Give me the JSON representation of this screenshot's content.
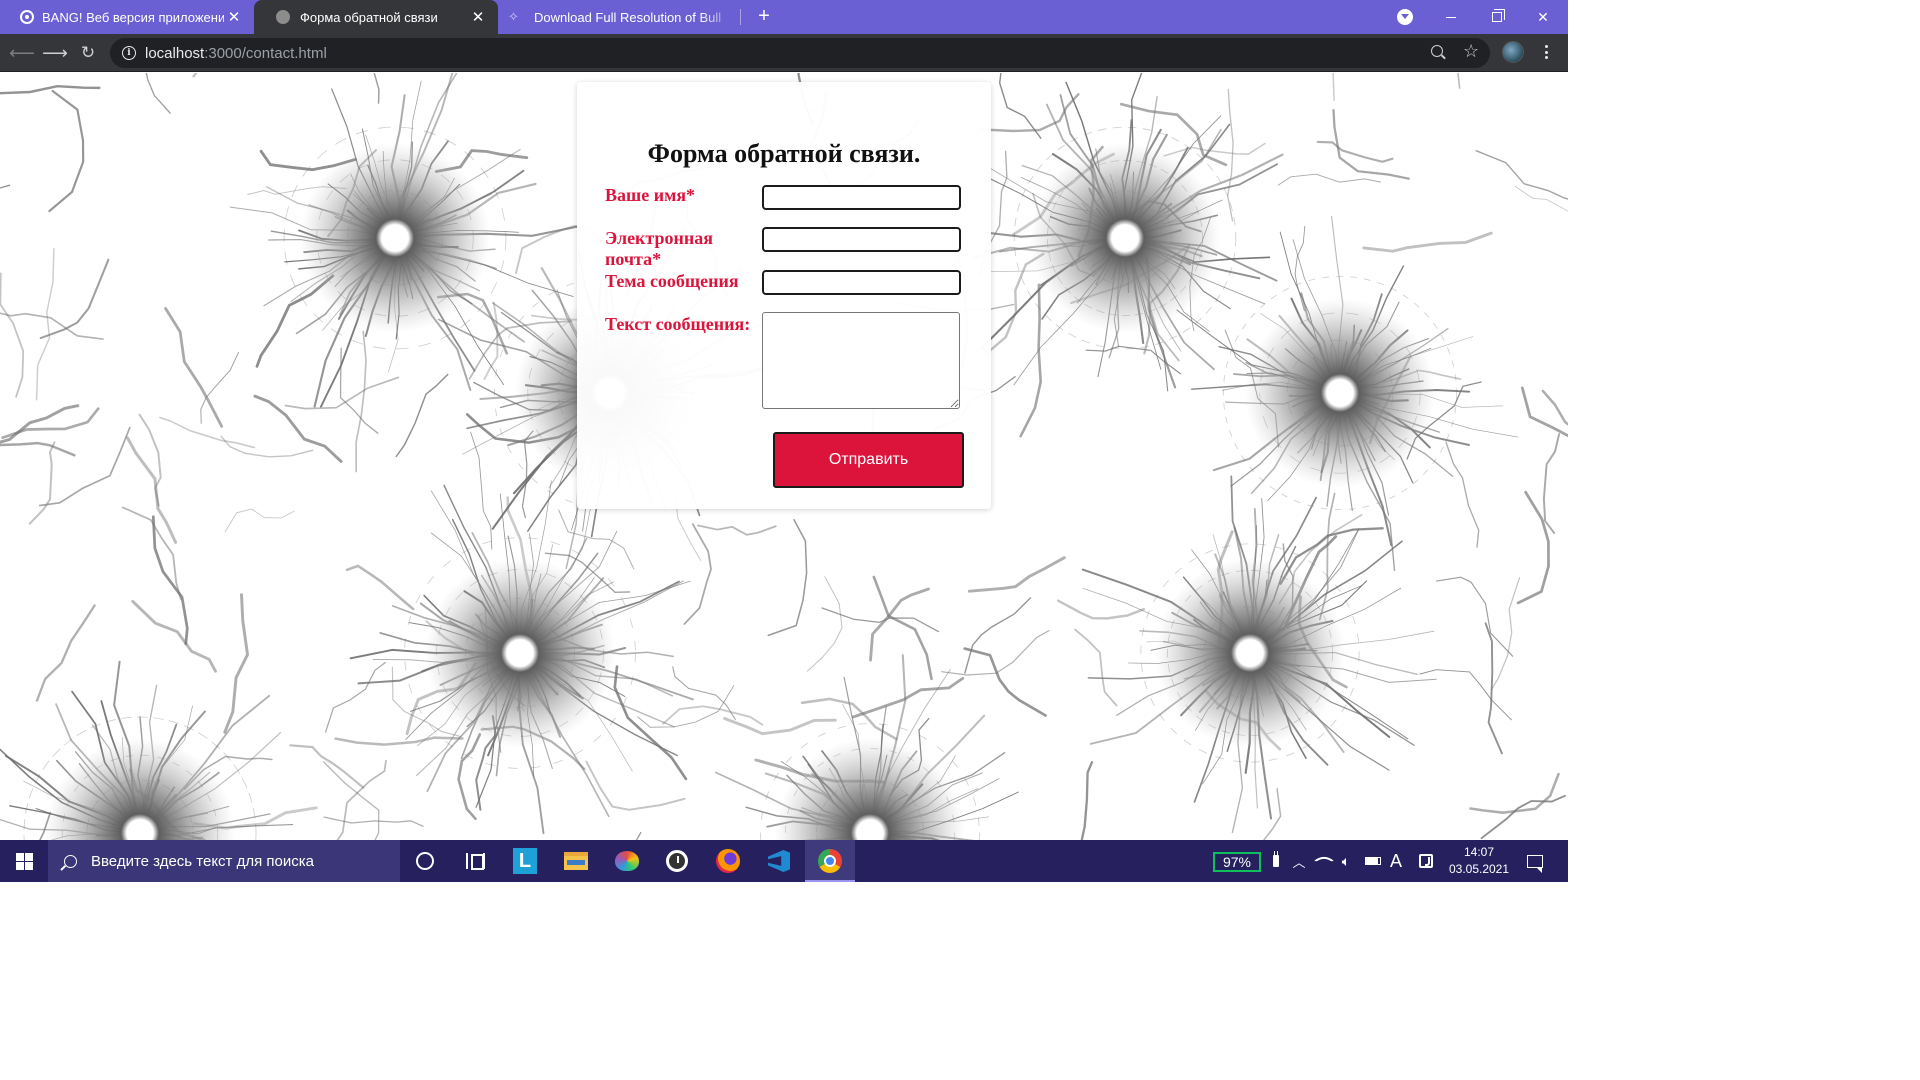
{
  "browser": {
    "tabs": [
      {
        "title": "BANG! Веб версия приложения",
        "icon": "globe-icon",
        "active": false
      },
      {
        "title": "Форма обратной связи",
        "icon": "globe-icon",
        "active": true
      },
      {
        "title": "Download Full Resolution of Bull",
        "icon": "bullet-icon",
        "active": false
      }
    ],
    "close_glyph": "✕",
    "new_tab_glyph": "+",
    "url": {
      "host": "localhost",
      "rest": ":3000/contact.html"
    },
    "accent_color": "#6a5fd3",
    "toolbar_color": "#35363a"
  },
  "form": {
    "title": "Форма обратной связи.",
    "labels": {
      "name": "Ваше имя*",
      "email": "Электронная почта*",
      "subject": "Тема сообщения",
      "message": "Текст сообщения:"
    },
    "values": {
      "name": "",
      "email": "",
      "subject": "",
      "message": ""
    },
    "submit_label": "Отправить",
    "label_color": "#dc143c",
    "button_color": "#dc143c"
  },
  "taskbar": {
    "search_placeholder": "Введите здесь текст для поиска",
    "apps": [
      "cortana-icon",
      "task-view-icon",
      "l-app-icon",
      "file-explorer-icon",
      "paint-icon",
      "clock-app-icon",
      "firefox-icon",
      "vscode-icon",
      "chrome-icon"
    ],
    "active_app": "chrome-icon",
    "battery_percent": "97%",
    "language": "A",
    "time": "14:07",
    "date": "03.05.2021",
    "color": "#26215e"
  }
}
